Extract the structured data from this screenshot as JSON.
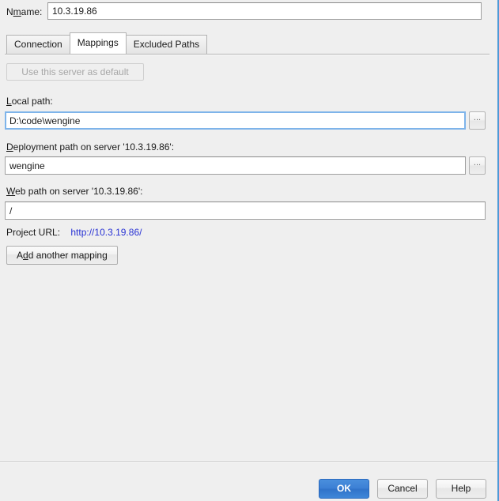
{
  "dialog": {
    "accent_color": "#4f9ad7",
    "background": "#efefef"
  },
  "name_row": {
    "label": "Name:",
    "label_mnemonic": "m",
    "value": "10.3.19.86",
    "placeholder": ""
  },
  "tabs": [
    {
      "label": "Connection",
      "active": false
    },
    {
      "label": "Mappings",
      "active": true
    },
    {
      "label": "Excluded Paths",
      "active": false
    }
  ],
  "default_server_button": {
    "label": "Use this server as default",
    "enabled": false
  },
  "fields": {
    "local_path": {
      "label": "Local path:",
      "label_mnemonic": "L",
      "value": "D:\\code\\wengine",
      "placeholder": "",
      "focused": true,
      "browse_label": "..."
    },
    "deployment_path": {
      "label": "Deployment path on server '10.3.19.86':",
      "label_mnemonic": "D",
      "value": "wengine",
      "placeholder": "",
      "focused": false,
      "browse_label": "..."
    },
    "web_path": {
      "label": "Web path on server '10.3.19.86':",
      "label_mnemonic": "W",
      "value": "/",
      "placeholder": "",
      "focused": false
    }
  },
  "project_url": {
    "label": "Project URL:",
    "url": "http://10.3.19.86/",
    "link_color": "#2832d4"
  },
  "add_mapping_button": {
    "label": "Add another mapping",
    "mnemonic": "d"
  },
  "footer": {
    "ok_label": "OK",
    "cancel_label": "Cancel",
    "help_label": "Help",
    "primary_color": "#3b7fd4"
  }
}
